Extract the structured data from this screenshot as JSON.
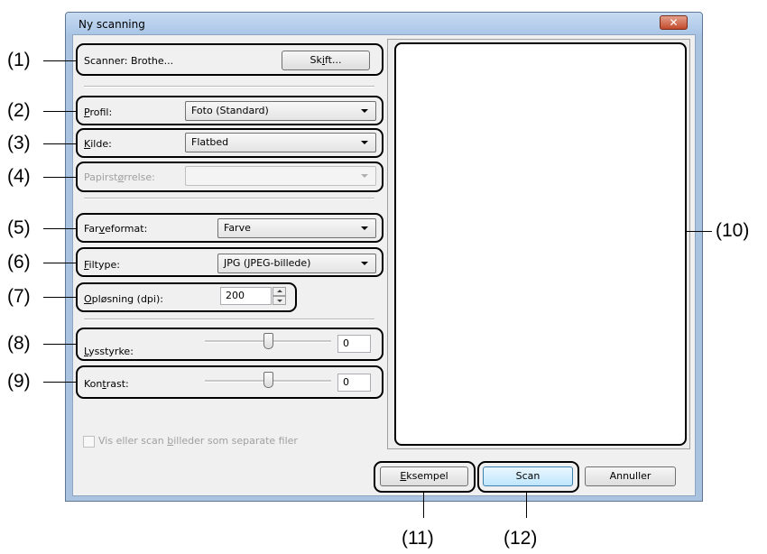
{
  "window": {
    "title": "Ny scanning",
    "close_glyph": "✕"
  },
  "scanner": {
    "label": "Scanner: Brothe...",
    "change_button": {
      "pre": "Sk",
      "key": "i",
      "post": "ft..."
    }
  },
  "profile": {
    "label_key": "P",
    "label_rest": "rofil:",
    "value": "Foto (Standard)"
  },
  "source": {
    "label_key": "K",
    "label_rest": "ilde:",
    "value": "Flatbed"
  },
  "paper_size": {
    "label_pre": "Papirst",
    "label_key": "ø",
    "label_post": "rrelse:",
    "value": ""
  },
  "color_format": {
    "label_pre": "Far",
    "label_key": "v",
    "label_post": "eformat:",
    "value": "Farve"
  },
  "file_type": {
    "label_key": "F",
    "label_rest": "iltype:",
    "value": "JPG (JPEG-billede)"
  },
  "resolution": {
    "label_key": "O",
    "label_rest": "pløsning (dpi):",
    "value": "200"
  },
  "brightness": {
    "label_key": "L",
    "label_rest": "ysstyrke:",
    "value": "0",
    "level": 0.5
  },
  "contrast": {
    "label_pre": "Kon",
    "label_key": "t",
    "label_post": "rast:",
    "value": "0",
    "level": 0.5
  },
  "separate_files": {
    "label_pre": "Vis eller scan ",
    "label_key": "b",
    "label_post": "illeder som separate filer",
    "checked": false
  },
  "buttons": {
    "preview": {
      "key": "E",
      "rest": "ksempel"
    },
    "scan": "Scan",
    "cancel": "Annuller"
  },
  "callouts": {
    "c1": "(1)",
    "c2": "(2)",
    "c3": "(3)",
    "c4": "(4)",
    "c5": "(5)",
    "c6": "(6)",
    "c7": "(7)",
    "c8": "(8)",
    "c9": "(9)",
    "c10": "(10)",
    "c11": "(11)",
    "c12": "(12)"
  }
}
